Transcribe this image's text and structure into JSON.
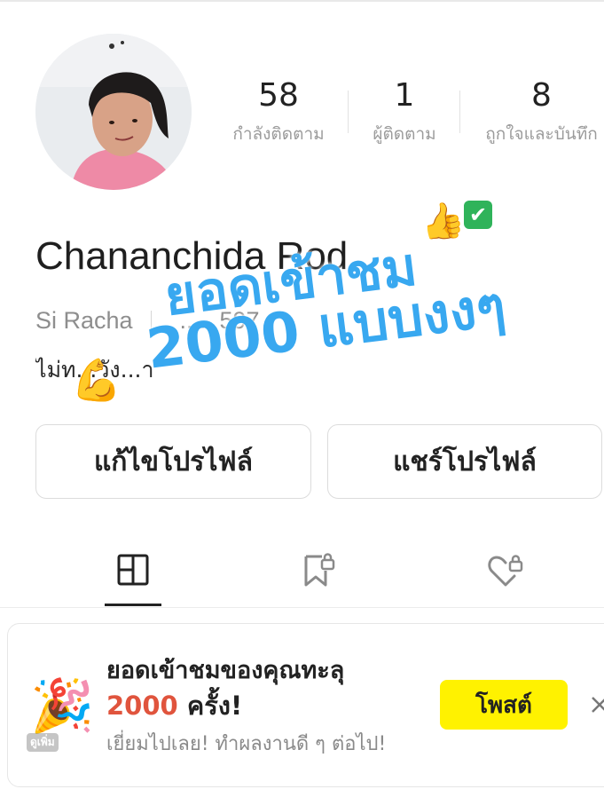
{
  "profile": {
    "name": "Chananchida Rod",
    "location": "Si Racha",
    "handle_partial": ".. .. .. 597",
    "bio_partial": "ไม่ท...วัง...า"
  },
  "stats": [
    {
      "value": "58",
      "label": "กำลังติดตาม"
    },
    {
      "value": "1",
      "label": "ผู้ติดตาม"
    },
    {
      "value": "8",
      "label": "ถูกใจและบันทึก"
    }
  ],
  "overlay": {
    "line1": "ยอดเข้าชม",
    "line2": "2000 แบบงงๆ",
    "emoji_thumb": "👍",
    "emoji_check": "✔",
    "emoji_flex": "💪"
  },
  "buttons": {
    "edit_profile": "แก้ไขโปรไฟล์",
    "share_profile": "แชร์โปรไฟล์"
  },
  "tabs": [
    {
      "icon": "grid-icon",
      "active": true
    },
    {
      "icon": "bookmark-lock-icon",
      "active": false
    },
    {
      "icon": "heart-lock-icon",
      "active": false
    }
  ],
  "notification": {
    "title": "ยอดเข้าชมของคุณทะลุ",
    "count": "2000",
    "count_suffix": " ครั้ง!",
    "subtitle": "เยี่ยมไปเลย! ทำผลงานดี ๆ ต่อไป!",
    "action": "โพสต์",
    "icon": "party-popper-icon",
    "icon_tag": "ดูเพิ่ม"
  },
  "colors": {
    "accent_yellow": "#fff200",
    "count_red": "#e0543d",
    "overlay_blue": "#38a8f0",
    "label_gray": "#9b9b9b"
  }
}
